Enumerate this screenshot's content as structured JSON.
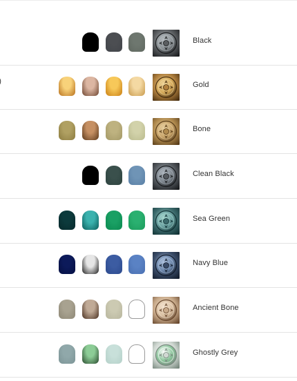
{
  "paint_sets": [
    {
      "name": "Black",
      "swatches": [
        {
          "top": "#000000",
          "bottom": "#000000"
        },
        {
          "top": "#4c4e52",
          "bottom": "#42454a"
        },
        {
          "top": "#6e776f",
          "bottom": "#606860"
        }
      ],
      "thumbnail": {
        "base": "#5a5d60",
        "dark": "#1c1e20",
        "light": "#b8bec2",
        "accent": "#8a9094"
      }
    },
    {
      "name": "Gold",
      "swatches": [
        {
          "top": "#f8d27a",
          "bottom": "#b7701e"
        },
        {
          "top": "#dcb6a2",
          "bottom": "#6d4530"
        },
        {
          "top": "#f7c859",
          "bottom": "#c97e12"
        },
        {
          "top": "#f4d9a3",
          "bottom": "#c89a4d"
        }
      ],
      "thumbnail": {
        "base": "#b0803e",
        "dark": "#4a3010",
        "light": "#f0d8a0",
        "accent": "#d4a858"
      }
    },
    {
      "name": "Bone",
      "swatches": [
        {
          "top": "#b0a062",
          "bottom": "#8c7c40"
        },
        {
          "top": "#c69063",
          "bottom": "#5c3a1c"
        },
        {
          "top": "#beb280",
          "bottom": "#a39866"
        },
        {
          "top": "#d2d2aa",
          "bottom": "#babb8e"
        }
      ],
      "thumbnail": {
        "base": "#b08a4e",
        "dark": "#5a3e1a",
        "light": "#e8d0a0",
        "accent": "#c8a46a"
      }
    },
    {
      "name": "Clean Black",
      "swatches": [
        {
          "top": "#000000",
          "bottom": "#000000"
        },
        {
          "top": "#3a504c",
          "bottom": "#2e4440"
        },
        {
          "top": "#6f94b6",
          "bottom": "#5a80a6"
        }
      ],
      "thumbnail": {
        "base": "#54595e",
        "dark": "#1a1c1f",
        "light": "#b0b8c0",
        "accent": "#7c848c"
      }
    },
    {
      "name": "Sea Green",
      "swatches": [
        {
          "top": "#0c3a3c",
          "bottom": "#082a2c"
        },
        {
          "top": "#3ab2ae",
          "bottom": "#0b5e5c"
        },
        {
          "top": "#1aa064",
          "bottom": "#0b8a50"
        },
        {
          "top": "#2ab070",
          "bottom": "#1c9c5c"
        }
      ],
      "thumbnail": {
        "base": "#3c6a6c",
        "dark": "#123436",
        "light": "#a8d8d0",
        "accent": "#6aa0a0"
      }
    },
    {
      "name": "Navy Blue",
      "swatches": [
        {
          "top": "#0c1a5a",
          "bottom": "#050f42"
        },
        {
          "top": "#e6e6e6",
          "bottom": "#1e1e1e"
        },
        {
          "top": "#3c5ca2",
          "bottom": "#2c4a8e"
        },
        {
          "top": "#5a82c4",
          "bottom": "#4a70b2"
        }
      ],
      "thumbnail": {
        "base": "#3a4c68",
        "dark": "#141e2e",
        "light": "#b0c4e0",
        "accent": "#6a84a8"
      }
    },
    {
      "name": "Ancient Bone",
      "swatches": [
        {
          "top": "#a8a290",
          "bottom": "#8e8876"
        },
        {
          "top": "#c0aa96",
          "bottom": "#4a3020"
        },
        {
          "top": "#cccab2",
          "bottom": "#b8b69e"
        },
        {
          "top": "#ffffff",
          "bottom": "#ffffff",
          "empty": true
        }
      ],
      "thumbnail": {
        "base": "#c8aa8a",
        "dark": "#6a4a30",
        "light": "#f6e6d2",
        "accent": "#d8bea0"
      }
    },
    {
      "name": "Ghostly Grey",
      "swatches": [
        {
          "top": "#90a8aa",
          "bottom": "#7c9496"
        },
        {
          "top": "#8ccc96",
          "bottom": "#2a4a2e"
        },
        {
          "top": "#c8e0da",
          "bottom": "#b4d0c8"
        },
        {
          "top": "#ffffff",
          "bottom": "#ffffff",
          "empty": true
        }
      ],
      "thumbnail": {
        "base": "#d0d8d2",
        "dark": "#7a8a80",
        "light": "#ffffff",
        "accent": "#8ac49a"
      }
    }
  ],
  "edge_fragment": ")"
}
